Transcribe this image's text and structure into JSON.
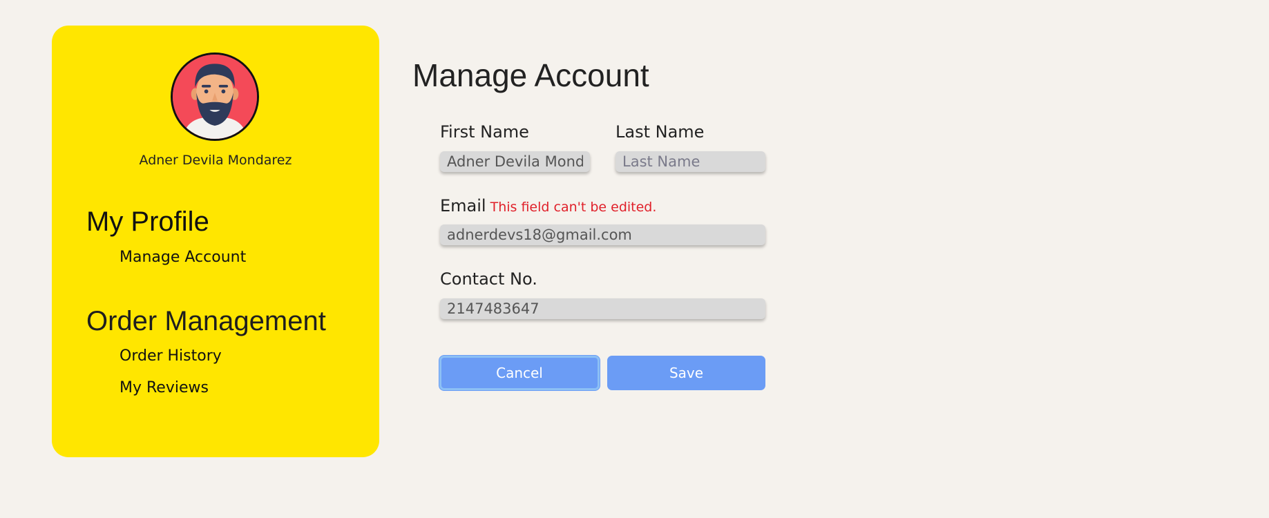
{
  "sidebar": {
    "user_name": "Adner Devila Mondarez",
    "sections": [
      {
        "title": "My Profile",
        "items": [
          "Manage Account"
        ]
      },
      {
        "title": "Order Management",
        "items": [
          "Order History",
          "My Reviews"
        ]
      }
    ]
  },
  "main": {
    "title": "Manage Account",
    "first_name": {
      "label": "First Name",
      "value": "Adner Devila Mondarez",
      "placeholder": "First Name"
    },
    "last_name": {
      "label": "Last Name",
      "value": "",
      "placeholder": "Last Name"
    },
    "email": {
      "label": "Email",
      "warning": "This field can't be edited.",
      "value": "adnerdevs18@gmail.com"
    },
    "contact": {
      "label": "Contact No.",
      "value": "2147483647"
    },
    "buttons": {
      "cancel": "Cancel",
      "save": "Save"
    }
  },
  "colors": {
    "background": "#f5f2ed",
    "sidebar": "#ffe600",
    "button": "#6b9cf5",
    "warning": "#e0202a",
    "input": "#d9d9d9"
  },
  "icons": {
    "avatar": "bearded-man-avatar"
  }
}
